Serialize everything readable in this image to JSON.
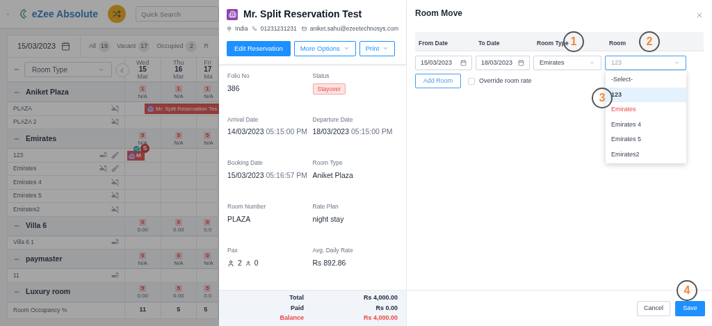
{
  "app_bar": {
    "logo_text": "eZee Absolute",
    "search": {
      "placeholder": "Quick Search"
    }
  },
  "calendar": {
    "date": "15/03/2023",
    "filters": [
      {
        "label": "All",
        "count": "19"
      },
      {
        "label": "Vacant",
        "count": "17"
      },
      {
        "label": "Occupied",
        "count": "2"
      },
      {
        "label": "R"
      }
    ],
    "room_type_filter": "Room Type",
    "days": [
      {
        "weekday": "Wed",
        "day": "15",
        "month": "Mar"
      },
      {
        "weekday": "Thu",
        "day": "16",
        "month": "Mar"
      },
      {
        "weekday": "Fri",
        "day": "17",
        "month": "Ma"
      }
    ],
    "rows": [
      {
        "kind": "group",
        "name": "Aniket Plaza",
        "cells": [
          {
            "count": "1",
            "rate": "N/A"
          },
          {
            "count": "1",
            "rate": "N/A"
          },
          {
            "count": "1",
            "rate": "N/A"
          }
        ]
      },
      {
        "kind": "room",
        "name": "PLAZA",
        "icons": [
          {
            "kind": "no_smoking"
          }
        ],
        "reservation": {
          "kind": "bar",
          "label": "Mr. Split Reservation Tes"
        }
      },
      {
        "kind": "room",
        "name": "PLAZA 2",
        "icons": [
          {
            "kind": "no_smoking"
          }
        ]
      },
      {
        "kind": "group",
        "name": "Emirates",
        "cells": [
          {
            "count": "5",
            "rate": "N/A"
          },
          {
            "count": "5",
            "rate": "N/A"
          },
          {
            "count": "5",
            "rate": "N/A"
          }
        ]
      },
      {
        "kind": "room",
        "name": "123",
        "icons": [
          {
            "kind": "smoking"
          },
          {
            "kind": "housekeeping"
          }
        ],
        "reservation": {
          "kind": "split",
          "label": "M",
          "badge": "S"
        }
      },
      {
        "kind": "room",
        "name": "Emirates",
        "icons": [
          {
            "kind": "no_smoking"
          },
          {
            "kind": "housekeeping"
          }
        ]
      },
      {
        "kind": "room",
        "name": "Emirates 4",
        "icons": [
          {
            "kind": "no_smoking"
          }
        ]
      },
      {
        "kind": "room",
        "name": "Emirates 5",
        "icons": [
          {
            "kind": "no_smoking"
          }
        ]
      },
      {
        "kind": "room",
        "name": "Emirates2",
        "icons": [
          {
            "kind": "no_smoking"
          }
        ]
      },
      {
        "kind": "group",
        "name": "Villa 6",
        "cells": [
          {
            "count": "0",
            "rate": "0.00"
          },
          {
            "count": "0",
            "rate": "0.00"
          },
          {
            "count": "0",
            "rate": "0.0"
          }
        ]
      },
      {
        "kind": "room",
        "name": "Villa 6 1",
        "icons": [
          {
            "kind": "smoking"
          }
        ]
      },
      {
        "kind": "group",
        "name": "paymaster",
        "cells": [
          {
            "count": "0",
            "rate": "N/A"
          },
          {
            "count": "0",
            "rate": "N/A"
          },
          {
            "count": "0",
            "rate": "N/A"
          }
        ]
      },
      {
        "kind": "room",
        "name": "11",
        "icons": [
          {
            "kind": "smoking"
          }
        ]
      },
      {
        "kind": "group",
        "name": "Luxury room",
        "cells": [
          {
            "count": "5",
            "rate": "0.00"
          },
          {
            "count": "5",
            "rate": "0.00"
          },
          {
            "count": "5",
            "rate": "0.0"
          }
        ]
      },
      {
        "kind": "total",
        "name": "Room Occupancy %",
        "values": [
          "11",
          "5",
          "5"
        ]
      }
    ]
  },
  "reservation": {
    "title": "Mr. Split Reservation Test",
    "country": "India",
    "phone": "01231231231",
    "email": "aniket.sahu@ezeetechnosys.com",
    "buttons": [
      {
        "label": "Edit Reservation",
        "kind": "primary"
      },
      {
        "label": "More Options",
        "kind": "dropdown"
      },
      {
        "label": "Print",
        "kind": "dropdown"
      }
    ],
    "details": [
      {
        "label": "Folio No",
        "value": "386",
        "kind": "text"
      },
      {
        "label": "Status",
        "value": "Stayover",
        "kind": "badge"
      },
      {
        "label": "Arrival Date",
        "value": "14/03/2023",
        "time": "05:15:00 PM",
        "kind": "datetime"
      },
      {
        "label": "Departure Date",
        "value": "18/03/2023",
        "time": "05:15:00 PM",
        "kind": "datetime"
      },
      {
        "label": "Booking Date",
        "value": "15/03/2023",
        "time": "05:16:57 PM",
        "kind": "datetime"
      },
      {
        "label": "Room Type",
        "value": "Aniket Plaza",
        "kind": "text"
      },
      {
        "label": "Room Number",
        "value": "PLAZA",
        "kind": "text"
      },
      {
        "label": "Rate Plan",
        "value": "night stay",
        "kind": "text"
      },
      {
        "label": "Pax",
        "adults": "2",
        "children": "0",
        "kind": "pax"
      },
      {
        "label": "Avg. Daily Rate",
        "value": "Rs 892.86",
        "kind": "text"
      }
    ],
    "totals": [
      {
        "label": "Total",
        "amount": "Rs 4,000.00",
        "kind": "normal"
      },
      {
        "label": "Paid",
        "amount": "Rs 0.00",
        "kind": "normal"
      },
      {
        "label": "Balance",
        "amount": "Rs 4,000.00",
        "kind": "due"
      }
    ]
  },
  "room_move": {
    "title": "Room Move",
    "columns": [
      "From Date",
      "To Date",
      "Room Type",
      "Room"
    ],
    "from_date": "15/03/2023",
    "to_date": "18/03/2023",
    "room_type": "Emirates",
    "room": "123",
    "add_room": "Add Room",
    "override": {
      "label": "Override room rate",
      "checked": false
    },
    "room_options": [
      {
        "label": "-Select-",
        "selected": false,
        "kind": "normal"
      },
      {
        "label": "123",
        "selected": true,
        "kind": "normal"
      },
      {
        "label": "Emirates",
        "selected": false,
        "kind": "alert"
      },
      {
        "label": "Emirates 4",
        "selected": false,
        "kind": "normal"
      },
      {
        "label": "Emirates 5",
        "selected": false,
        "kind": "normal"
      },
      {
        "label": "Emirates2",
        "selected": false,
        "kind": "normal"
      }
    ],
    "buttons": [
      {
        "label": "Cancel",
        "kind": "secondary"
      },
      {
        "label": "Save",
        "kind": "primary"
      }
    ]
  },
  "annotations": [
    "1",
    "2",
    "3",
    "4"
  ]
}
